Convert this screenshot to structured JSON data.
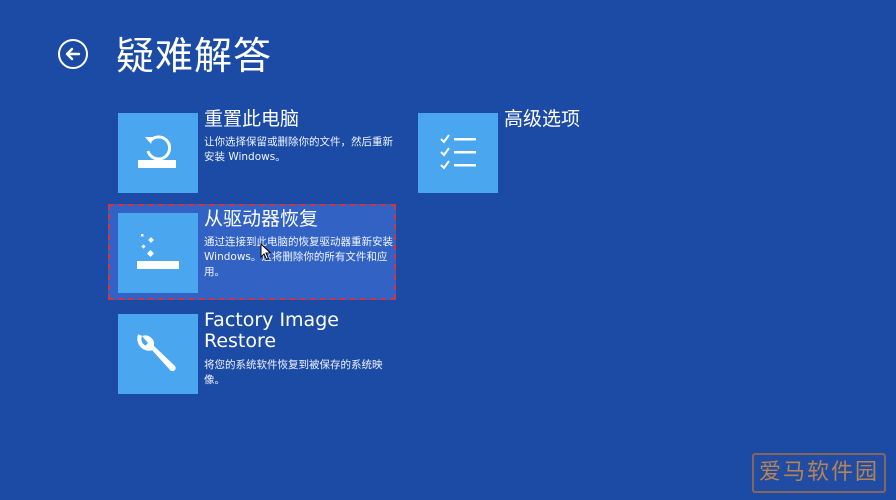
{
  "header": {
    "title": "疑难解答"
  },
  "options": [
    {
      "title": "重置此电脑",
      "description": "让你选择保留或删除你的文件，然后重新安装 Windows。",
      "icon": "reset-pc-icon"
    },
    {
      "title": "高级选项",
      "description": "",
      "icon": "checklist-icon"
    },
    {
      "title": "从驱动器恢复",
      "description": "通过连接到此电脑的恢复驱动器重新安装 Windows。这将删除你的所有文件和应用。",
      "icon": "drive-recovery-icon"
    },
    {
      "title": "Factory Image Restore",
      "description": "将您的系统软件恢复到被保存的系统映像。",
      "icon": "wrench-icon"
    }
  ],
  "watermark": {
    "text": "爱马软件园"
  },
  "colors": {
    "background": "#1c4ba6",
    "tile": "#4aa6ee",
    "selection_border": "#c9374a"
  }
}
